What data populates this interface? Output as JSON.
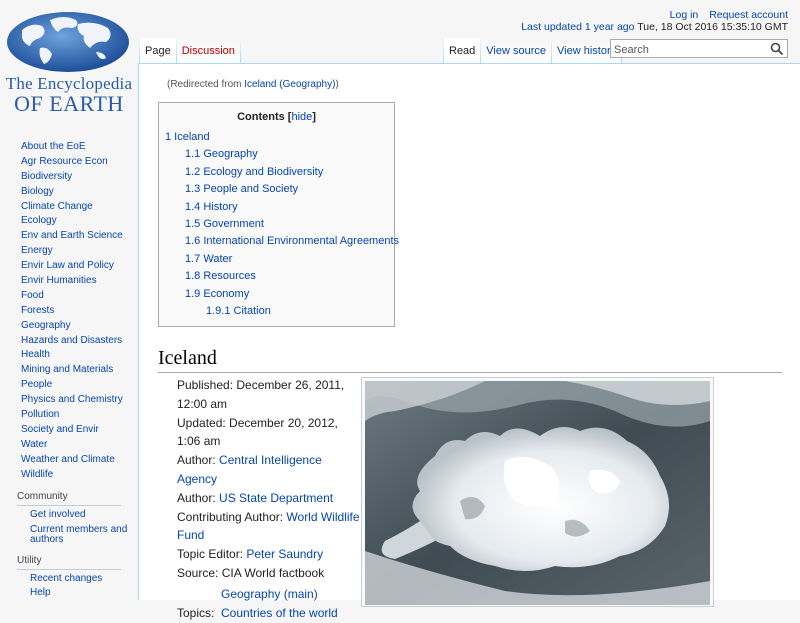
{
  "logo": {
    "line1": "The Encyclopedia",
    "line2": "OF EARTH"
  },
  "personal": {
    "login": "Log in",
    "request": "Request account",
    "updated_link": "Last updated 1 year ago",
    "updated_date": " Tue, 18 Oct 2016 15:35:10 GMT"
  },
  "tabs": {
    "page": "Page",
    "discussion": "Discussion",
    "read": "Read",
    "view_source": "View source",
    "view_history": "View history"
  },
  "search": {
    "placeholder": "Search"
  },
  "sidebar": {
    "items": [
      "About the EoE",
      "Agr Resource Econ",
      "Biodiversity",
      "Biology",
      "Climate Change",
      "Ecology",
      "Env and Earth Science",
      "Energy",
      "Envir Law and Policy",
      "Envir Humanities",
      "Food",
      "Forests",
      "Geography",
      "Hazards and Disasters",
      "Health",
      "Mining and Materials",
      "People",
      "Physics and Chemistry",
      "Pollution",
      "Society and Envir",
      "Water",
      "Weather and Climate",
      "Wildlife"
    ],
    "community": {
      "heading": "Community",
      "items": [
        "Get involved",
        "Current members and authors"
      ]
    },
    "utility": {
      "heading": "Utility",
      "items": [
        "Recent changes",
        "Help"
      ]
    }
  },
  "redirect": {
    "prefix": "(Redirected from ",
    "link": "Iceland (Geography)",
    "suffix": ")"
  },
  "toc": {
    "title": "Contents",
    "hide": "hide",
    "items": [
      {
        "level": 1,
        "text": "1 Iceland"
      },
      {
        "level": 2,
        "text": "1.1 Geography"
      },
      {
        "level": 2,
        "text": "1.2 Ecology and Biodiversity"
      },
      {
        "level": 2,
        "text": "1.3 People and Society"
      },
      {
        "level": 2,
        "text": "1.4 History"
      },
      {
        "level": 2,
        "text": "1.5 Government"
      },
      {
        "level": 2,
        "text": "1.6 International Environmental Agreements"
      },
      {
        "level": 2,
        "text": "1.7 Water"
      },
      {
        "level": 2,
        "text": "1.8 Resources"
      },
      {
        "level": 2,
        "text": "1.9 Economy"
      },
      {
        "level": 3,
        "text": "1.9.1 Citation"
      }
    ]
  },
  "article": {
    "title": "Iceland",
    "published_label": "Published: ",
    "published": "December 26, 2011, 12:00 am",
    "updated_label": "Updated: ",
    "updated": "December 20, 2012, 1:06 am",
    "author_label": "Author: ",
    "authors": [
      "Central Intelligence Agency",
      "US State Department"
    ],
    "contributing_label": "Contributing Author: ",
    "contributing": "World Wildlife Fund",
    "topic_editor_label": "Topic Editor: ",
    "topic_editor": "Peter Saundry",
    "source_label": "Source: ",
    "source": "CIA World factbook",
    "topics_label": "Topics:",
    "topics": [
      "Geography (main)",
      "Countries of the world"
    ]
  },
  "colors": {
    "link": "#0645ad",
    "redlink": "#ba0000",
    "border": "#a7d7f9"
  }
}
